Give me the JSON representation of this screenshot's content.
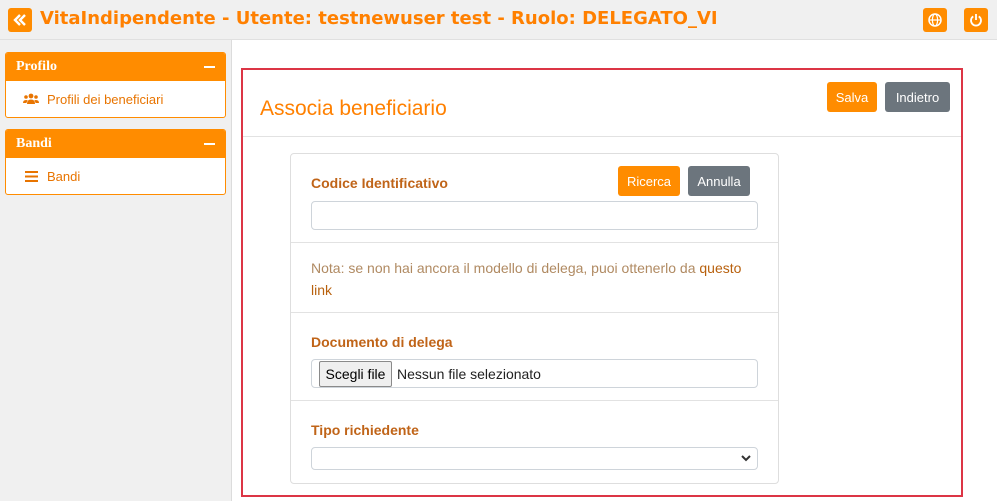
{
  "header": {
    "title": "VitaIndipendente - Utente: testnewuser test - Ruolo: DELEGATO_VI",
    "collapse_icon": "double-chevron-left-icon",
    "language_icon": "globe-icon",
    "logout_icon": "power-icon"
  },
  "sidebar": {
    "panels": [
      {
        "title": "Profilo",
        "items": [
          {
            "label": "Profili dei beneficiari",
            "icon": "users-icon"
          }
        ]
      },
      {
        "title": "Bandi",
        "items": [
          {
            "label": "Bandi",
            "icon": "list-icon"
          }
        ]
      }
    ]
  },
  "main": {
    "title": "Associa beneficiario",
    "save_label": "Salva",
    "back_label": "Indietro",
    "form": {
      "codice_label": "Codice Identificativo",
      "search_label": "Ricerca",
      "cancel_label": "Annulla",
      "codice_value": "",
      "note_text": "Nota: se non hai ancora il modello di delega, puoi ottenerlo da",
      "note_link": "questo link",
      "documento_label": "Documento di delega",
      "file_button": "Scegli file",
      "file_status": "Nessun file selezionato",
      "tipo_label": "Tipo richiedente",
      "tipo_value": ""
    }
  },
  "colors": {
    "accent": "#ff8c00",
    "title": "#ff8000",
    "frame": "#dc3545",
    "gray_button": "#6c757d"
  }
}
